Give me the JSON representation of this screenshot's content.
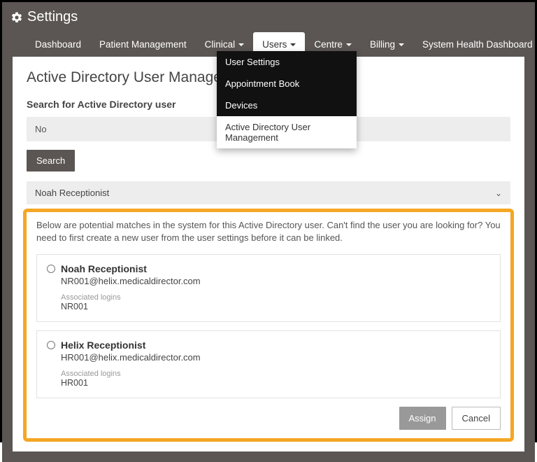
{
  "header": {
    "title": "Settings"
  },
  "nav": {
    "items": [
      {
        "label": "Dashboard",
        "caret": false
      },
      {
        "label": "Patient Management",
        "caret": false
      },
      {
        "label": "Clinical",
        "caret": true
      },
      {
        "label": "Users",
        "caret": true,
        "active": true
      },
      {
        "label": "Centre",
        "caret": true
      },
      {
        "label": "Billing",
        "caret": true
      },
      {
        "label": "System Health Dashboard",
        "caret": false
      }
    ]
  },
  "dropdown": {
    "items": [
      {
        "label": "User Settings"
      },
      {
        "label": "Appointment Book"
      },
      {
        "label": "Devices"
      },
      {
        "label": "Active Directory User Management",
        "active": true
      }
    ]
  },
  "page": {
    "title": "Active Directory User Management",
    "search_label": "Search for Active Directory user",
    "search_value": "No",
    "search_button": "Search",
    "select_value": "Noah Receptionist"
  },
  "matches": {
    "help_text": "Below are potential matches in the system for this Active Directory user. Can't find the user you are looking for? You need to first create a new user from the user settings before it can be linked.",
    "assoc_label": "Associated logins",
    "items": [
      {
        "name": "Noah Receptionist",
        "email": "NR001@helix.medicaldirector.com",
        "login": "NR001"
      },
      {
        "name": "Helix Receptionist",
        "email": "HR001@helix.medicaldirector.com",
        "login": "HR001"
      }
    ],
    "assign_label": "Assign",
    "cancel_label": "Cancel"
  }
}
